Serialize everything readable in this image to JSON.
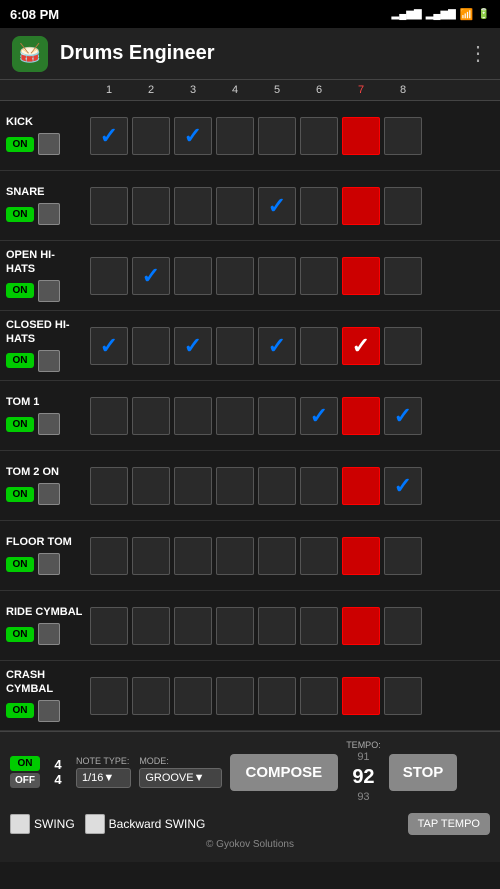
{
  "status": {
    "time": "6:08 PM",
    "signal": "▂▄▆",
    "wifi": "WiFi",
    "battery": "🔋"
  },
  "header": {
    "title": "Drums Engineer",
    "logo": "🥁",
    "menu_icon": "⋮"
  },
  "columns": [
    "1",
    "2",
    "3",
    "4",
    "5",
    "6",
    "7",
    "8"
  ],
  "highlight_col": 6,
  "rows": [
    {
      "name": "KICK",
      "checked": [
        0,
        2
      ],
      "highlight_checked": []
    },
    {
      "name": "SNARE",
      "checked": [
        4
      ],
      "highlight_checked": []
    },
    {
      "name": "OPEN HI-HATS",
      "checked": [
        1
      ],
      "highlight_checked": []
    },
    {
      "name": "CLOSED HI-HATS",
      "checked": [
        0,
        2,
        4
      ],
      "highlight_checked": [
        6
      ]
    },
    {
      "name": "TOM 1",
      "checked": [
        5
      ],
      "highlight_checked": [],
      "extra_checked": [
        7
      ]
    },
    {
      "name": "TOM 2 ON",
      "checked": [
        7
      ],
      "highlight_checked": []
    },
    {
      "name": "FLOOR TOM",
      "checked": [],
      "highlight_checked": []
    },
    {
      "name": "RIDE CYMBAL",
      "checked": [],
      "highlight_checked": []
    },
    {
      "name": "CRASH CYMBAL",
      "checked": [],
      "highlight_checked": []
    }
  ],
  "bottom": {
    "on_label": "ON",
    "off_label": "OFF",
    "time_sig_top": "4",
    "time_sig_bot": "4",
    "note_type_label": "NOTE TYPE:",
    "note_type_value": "1/16",
    "mode_label": "MODE:",
    "mode_value": "GROOVE",
    "compose_label": "COMPOSE",
    "tempo_label": "TEMPO:",
    "tempo_prev": "91",
    "tempo_current": "92",
    "tempo_next": "93",
    "stop_label": "STOP",
    "swing_label": "SWING",
    "backward_swing_label": "Backward SWING",
    "tap_tempo_label": "TAP TEMPO",
    "copyright": "© Gyokov Solutions"
  }
}
